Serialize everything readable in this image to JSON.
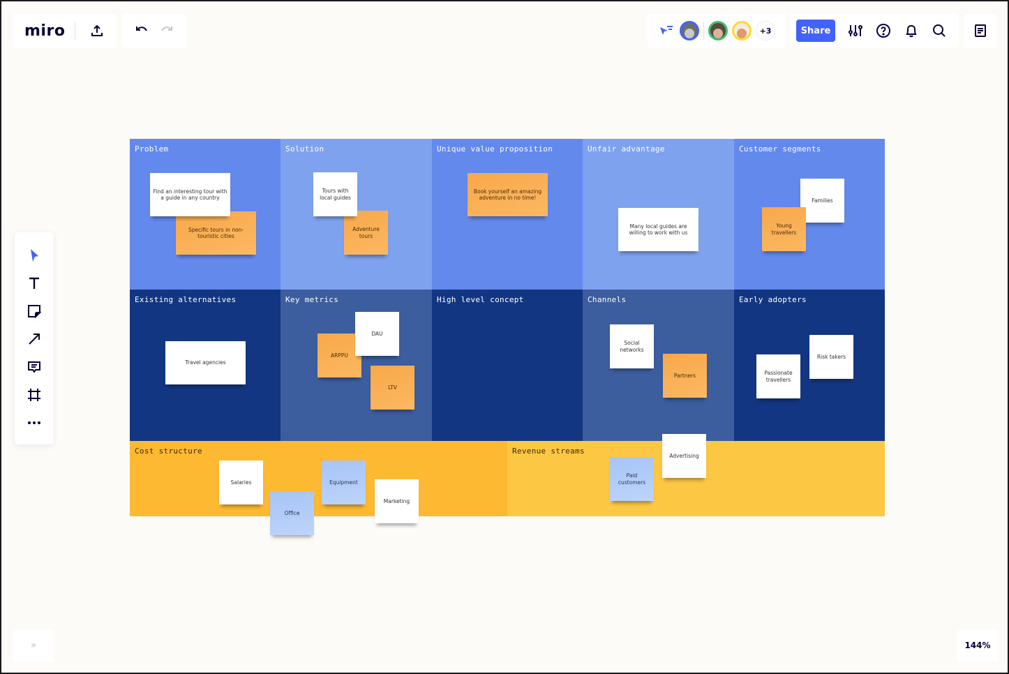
{
  "app": {
    "logo": "miro",
    "zoom_level": "144%"
  },
  "header": {
    "collaborators": [
      {
        "name": "collaborator-1",
        "ring_color": "#4262ff",
        "face_color": "#3a3a3a"
      },
      {
        "name": "collaborator-2",
        "ring_color": "#3dbf6e",
        "face_color": "#6b4a38"
      },
      {
        "name": "collaborator-3",
        "ring_color": "#fddb2c",
        "face_color": "#d98a5a"
      }
    ],
    "more_collaborators": "+3",
    "share_label": "Share"
  },
  "colors": {
    "accent": "#4262ff",
    "canvas_bg": "#fcfbf8",
    "cell_blue": "#6389ec",
    "cell_light_blue": "#7ea2ee",
    "cell_navy": "#133682",
    "cell_mid_navy": "#3c5d9e",
    "cell_orange": "#feb933",
    "cell_yellow": "#fcc844"
  },
  "board": {
    "cells": [
      {
        "title": "Problem"
      },
      {
        "title": "Solution"
      },
      {
        "title": "Unique value proposition"
      },
      {
        "title": "Unfair advantage"
      },
      {
        "title": "Customer segments"
      },
      {
        "title": "Existing alternatives"
      },
      {
        "title": "Key metrics"
      },
      {
        "title": "High level concept"
      },
      {
        "title": "Channels"
      },
      {
        "title": "Early adopters"
      },
      {
        "title": "Cost structure"
      },
      {
        "title": "Revenue streams"
      }
    ],
    "stickies": [
      {
        "text": "Find an interesting tour with a guide in any country",
        "color": "white",
        "cell": "Problem"
      },
      {
        "text": "Specific tours in non-touristic cities",
        "color": "orange",
        "cell": "Problem"
      },
      {
        "text": "Tours with local guides",
        "color": "white",
        "cell": "Solution"
      },
      {
        "text": "Adventure tours",
        "color": "orange",
        "cell": "Solution"
      },
      {
        "text": "Book yourself an amazing adventure in no time!",
        "color": "orange",
        "cell": "Unique value proposition"
      },
      {
        "text": "Many local guides are willing to work with us",
        "color": "white",
        "cell": "Unfair advantage"
      },
      {
        "text": "Families",
        "color": "white",
        "cell": "Customer segments"
      },
      {
        "text": "Young travellers",
        "color": "orange",
        "cell": "Customer segments"
      },
      {
        "text": "Travel agencies",
        "color": "white",
        "cell": "Existing alternatives"
      },
      {
        "text": "DAU",
        "color": "white",
        "cell": "Key metrics"
      },
      {
        "text": "ARPPU",
        "color": "orange",
        "cell": "Key metrics"
      },
      {
        "text": "LTV",
        "color": "orange",
        "cell": "Key metrics"
      },
      {
        "text": "Social networks",
        "color": "white",
        "cell": "Channels"
      },
      {
        "text": "Partners",
        "color": "orange",
        "cell": "Channels"
      },
      {
        "text": "Risk takers",
        "color": "white",
        "cell": "Early adopters"
      },
      {
        "text": "Passionate travellers",
        "color": "white",
        "cell": "Early adopters"
      },
      {
        "text": "Salaries",
        "color": "white",
        "cell": "Cost structure"
      },
      {
        "text": "Office",
        "color": "blue",
        "cell": "Cost structure"
      },
      {
        "text": "Equipment",
        "color": "blue",
        "cell": "Cost structure"
      },
      {
        "text": "Marketing",
        "color": "white",
        "cell": "Cost structure"
      },
      {
        "text": "Advertising",
        "color": "white",
        "cell": "Revenue streams"
      },
      {
        "text": "Paid customers",
        "color": "blue",
        "cell": "Revenue streams"
      }
    ]
  },
  "toolbar": {
    "tools": [
      {
        "name": "select",
        "icon": "cursor-icon",
        "active": true
      },
      {
        "name": "text",
        "icon": "text-icon"
      },
      {
        "name": "sticky-note",
        "icon": "sticky-note-icon"
      },
      {
        "name": "line",
        "icon": "arrow-icon"
      },
      {
        "name": "comment",
        "icon": "comment-icon"
      },
      {
        "name": "frame",
        "icon": "frame-icon"
      },
      {
        "name": "more",
        "icon": "more-icon"
      }
    ]
  }
}
